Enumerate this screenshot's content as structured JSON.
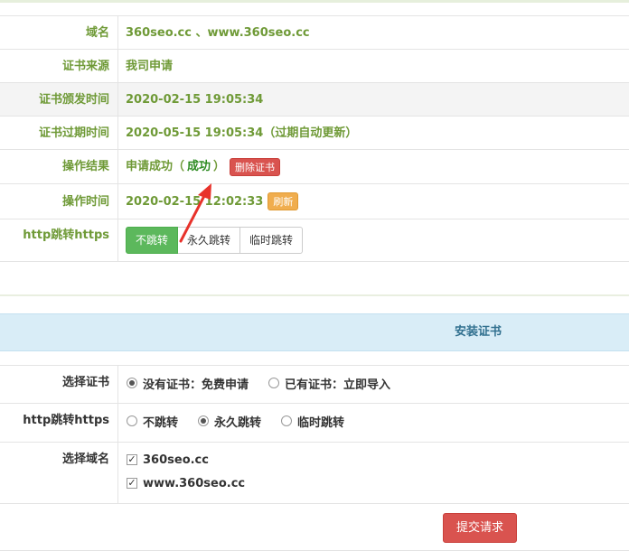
{
  "info": {
    "domain_label": "域名",
    "domain_value": "360seo.cc 、www.360seo.cc",
    "source_label": "证书来源",
    "source_value": "我司申请",
    "issued_label": "证书颁发时间",
    "issued_value": "2020-02-15 19:05:34",
    "expire_label": "证书过期时间",
    "expire_value": "2020-05-15 19:05:34（过期自动更新）",
    "result_label": "操作结果",
    "result_prefix": "申请成功（",
    "result_status": "成功",
    "result_suffix": "）",
    "delete_button": "删除证书",
    "optime_label": "操作时间",
    "optime_value": "2020-02-15 12:02:33",
    "refresh_button": "刷新",
    "redirect_label": "http跳转https",
    "redirect_options": [
      "不跳转",
      "永久跳转",
      "临时跳转"
    ],
    "redirect_selected": "不跳转"
  },
  "install": {
    "title": "安装证书",
    "cert_label": "选择证书",
    "cert_options": [
      "没有证书：免费申请",
      "已有证书：立即导入"
    ],
    "cert_selected": "没有证书：免费申请",
    "redirect_label": "http跳转https",
    "redirect_options": [
      "不跳转",
      "永久跳转",
      "临时跳转"
    ],
    "redirect_selected": "永久跳转",
    "domain_label": "选择域名",
    "domains": [
      "360seo.cc",
      "www.360seo.cc"
    ],
    "submit_button": "提交请求"
  },
  "colors": {
    "label_green": "#6f9a37",
    "success_green": "#2e8b22",
    "danger": "#d9534f",
    "warning": "#f0ad4e",
    "primary_green": "#5cb85c",
    "panel_bg": "#d9edf7",
    "arrow": "#e8322b"
  }
}
